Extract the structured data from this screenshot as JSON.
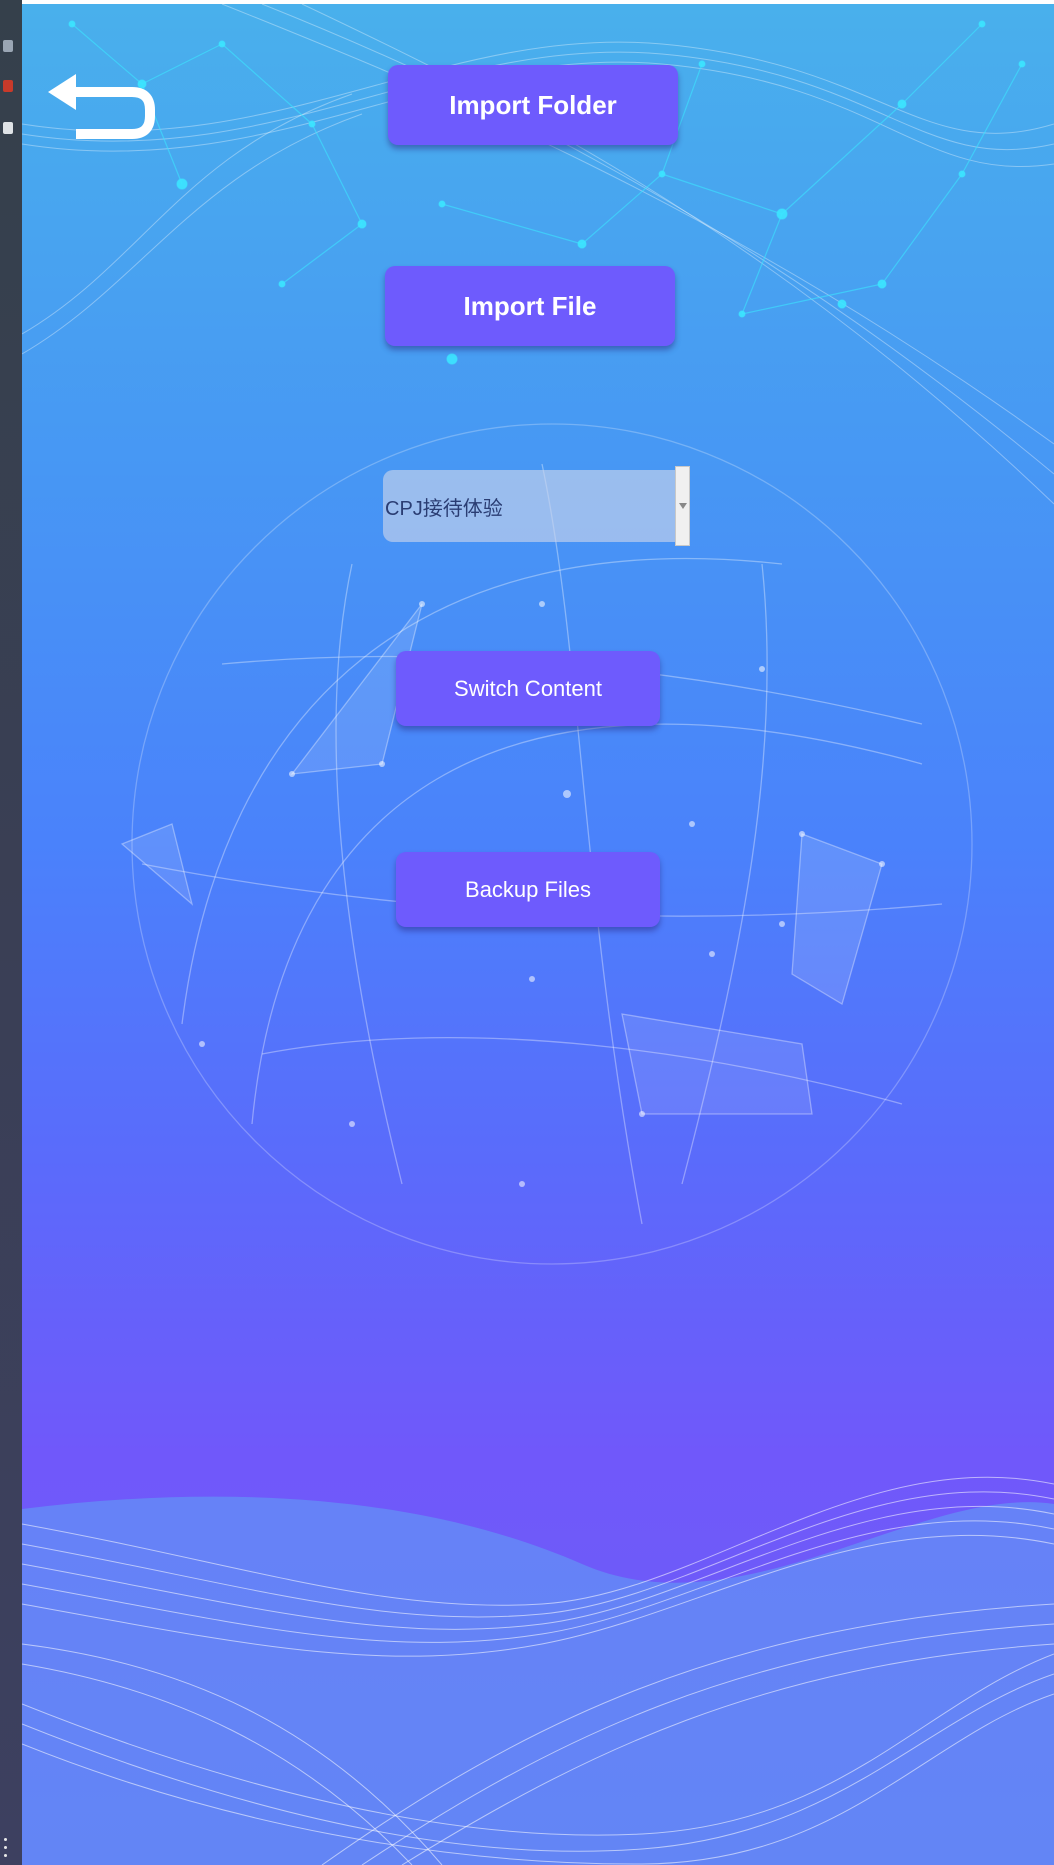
{
  "buttons": {
    "import_folder": "Import Folder",
    "import_file": "Import File",
    "switch_content": "Switch Content",
    "backup_files": "Backup Files"
  },
  "content_select": {
    "selected": "CPJ接待体验"
  },
  "icons": {
    "back": "return-arrow-icon",
    "dropdown": "triangle-down-icon"
  },
  "colors": {
    "button": "#6e5bfd",
    "background_top": "#49b0ec",
    "background_bottom": "#7058fa"
  }
}
